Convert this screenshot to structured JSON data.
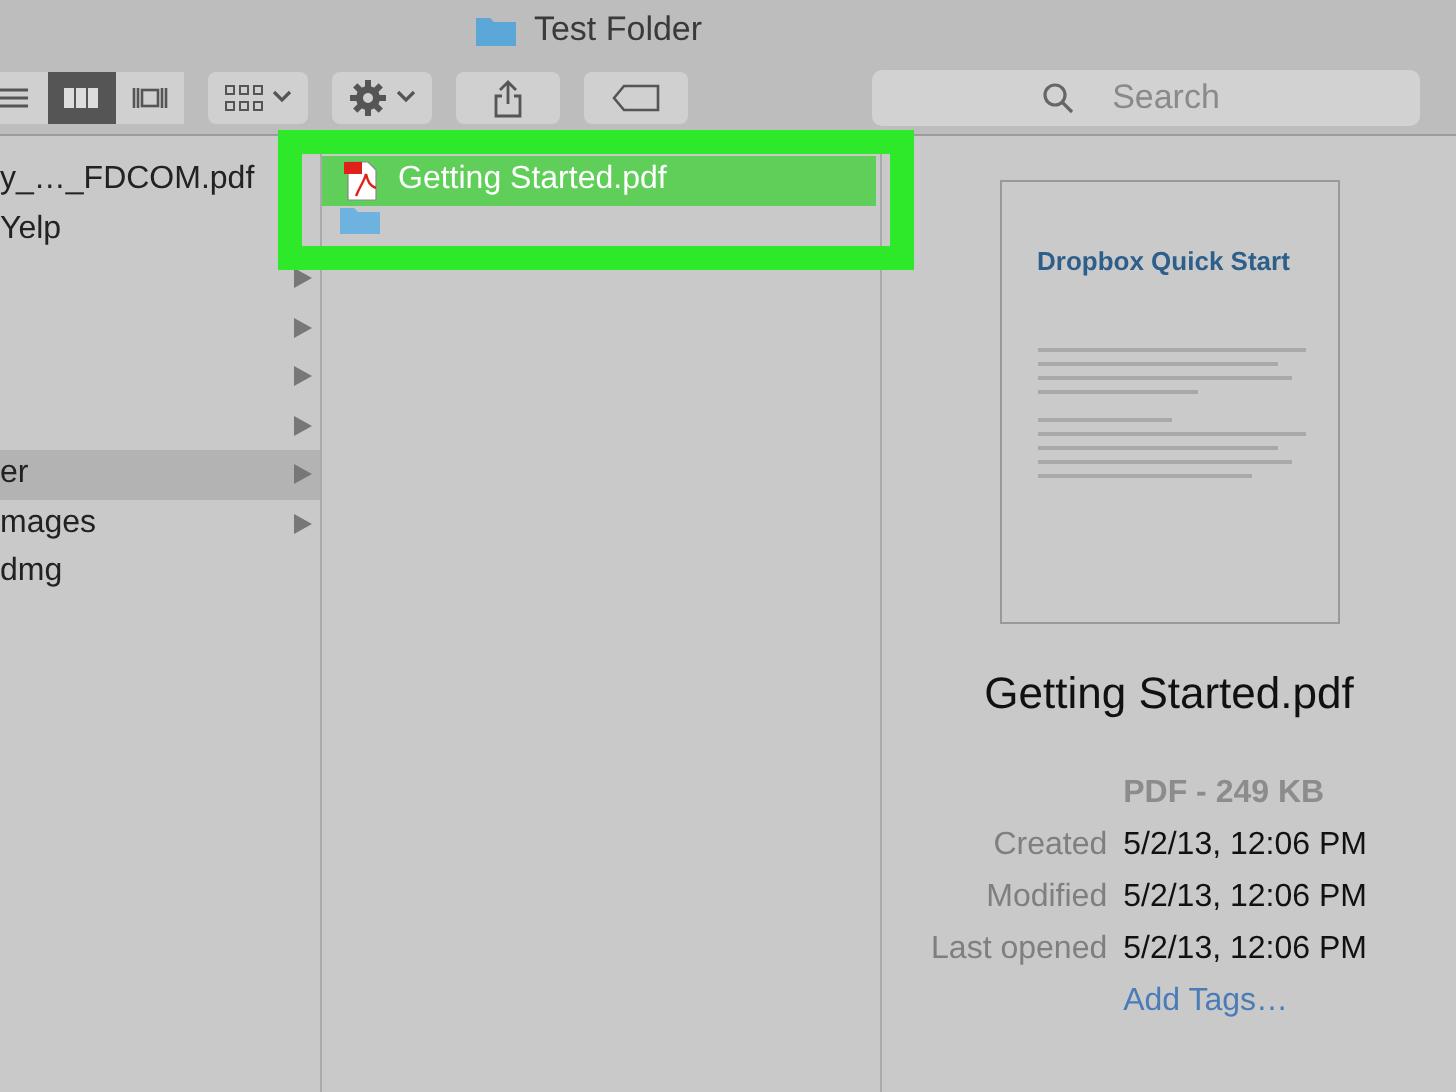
{
  "window": {
    "title": "Test Folder"
  },
  "toolbar": {
    "view_modes": [
      {
        "selected": false
      },
      {
        "selected": true
      },
      {
        "selected": false
      }
    ],
    "search": {
      "placeholder": "Search"
    }
  },
  "columns": [
    {
      "items": [
        {
          "name": "y_…_FDCOM.pdf",
          "kind": "file",
          "selected": false
        },
        {
          "name": "Yelp",
          "kind": "file",
          "selected": false
        },
        {
          "kind": "folder",
          "selected": false
        },
        {
          "kind": "folder",
          "selected": false
        },
        {
          "kind": "folder",
          "selected": false
        },
        {
          "kind": "folder",
          "selected": false
        },
        {
          "name": "er",
          "kind": "folder",
          "selected": true
        },
        {
          "name": "mages",
          "kind": "folder",
          "selected": false
        },
        {
          "name": "dmg",
          "kind": "file",
          "selected": false
        }
      ]
    },
    {
      "items": [
        {
          "name": "Getting Started.pdf",
          "kind": "pdf",
          "selected": true
        },
        {
          "kind": "folder",
          "selected": false
        }
      ]
    }
  ],
  "preview": {
    "document_title": "Dropbox Quick Start",
    "file_name": "Getting Started.pdf",
    "kind_size": "PDF - 249 KB",
    "info": [
      {
        "label": "Created",
        "value": "5/2/13, 12:06 PM"
      },
      {
        "label": "Modified",
        "value": "5/2/13, 12:06 PM"
      },
      {
        "label": "Last opened",
        "value": "5/2/13, 12:06 PM"
      }
    ],
    "add_tags": "Add Tags…"
  }
}
